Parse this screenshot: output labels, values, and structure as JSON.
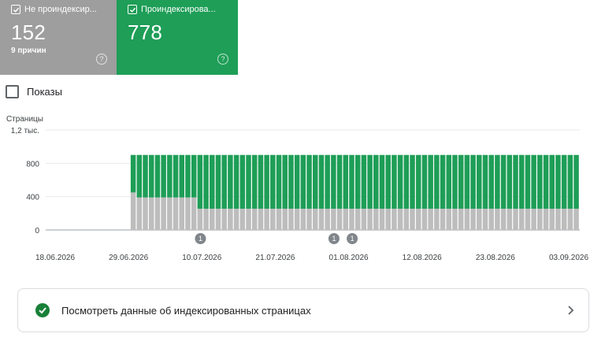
{
  "cards": {
    "not_indexed": {
      "label": "Не проиндексир...",
      "value": "152",
      "sub": "9 причин",
      "color": "#9e9e9e",
      "checked": true
    },
    "indexed": {
      "label": "Проиндексирова...",
      "value": "778",
      "color": "#1e9e57",
      "checked": true
    }
  },
  "impressions_toggle": {
    "label": "Показы",
    "checked": false
  },
  "chart_data": {
    "type": "bar",
    "stacked": true,
    "ylabel": "Страницы",
    "yticks": [
      "1,2 тыс.",
      "800",
      "400",
      "0"
    ],
    "ylim": [
      0,
      1200
    ],
    "grid": true,
    "xtick_labels": [
      "18.06.2026",
      "29.06.2026",
      "10.07.2026",
      "21.07.2026",
      "01.08.2026",
      "12.08.2026",
      "23.08.2026",
      "03.09.2026"
    ],
    "annotations": [
      {
        "category_index": 25,
        "label": "1"
      },
      {
        "category_index": 47,
        "label": "1"
      },
      {
        "category_index": 50,
        "label": "1"
      }
    ],
    "series": [
      {
        "color": "#bdbdbd",
        "values": [
          0,
          0,
          0,
          0,
          0,
          0,
          0,
          0,
          0,
          0,
          0,
          0,
          0,
          0,
          450,
          390,
          390,
          390,
          390,
          390,
          390,
          390,
          390,
          390,
          390,
          255,
          255,
          255,
          255,
          255,
          255,
          255,
          255,
          255,
          255,
          255,
          255,
          255,
          255,
          255,
          255,
          255,
          255,
          255,
          255,
          255,
          255,
          255,
          255,
          255,
          255,
          255,
          255,
          255,
          255,
          255,
          255,
          255,
          255,
          255,
          255,
          255,
          255,
          255,
          255,
          255,
          255,
          255,
          255,
          255,
          255,
          255,
          255,
          255,
          255,
          255,
          255,
          255,
          255,
          255,
          255,
          255,
          255,
          255,
          255,
          255,
          255,
          255
        ]
      },
      {
        "color": "#1e9e57",
        "values": [
          0,
          0,
          0,
          0,
          0,
          0,
          0,
          0,
          0,
          0,
          0,
          0,
          0,
          0,
          450,
          510,
          510,
          510,
          510,
          510,
          510,
          510,
          510,
          510,
          510,
          645,
          645,
          645,
          645,
          645,
          645,
          645,
          645,
          645,
          645,
          645,
          645,
          645,
          645,
          645,
          645,
          645,
          645,
          645,
          645,
          645,
          645,
          645,
          645,
          645,
          645,
          645,
          645,
          645,
          645,
          645,
          645,
          645,
          645,
          645,
          645,
          645,
          645,
          645,
          645,
          645,
          645,
          645,
          645,
          645,
          645,
          645,
          645,
          645,
          645,
          645,
          645,
          645,
          645,
          645,
          645,
          645,
          645,
          645,
          645,
          645,
          645,
          645
        ]
      }
    ]
  },
  "details_link": {
    "label": "Посмотреть данные об индексированных страницах"
  }
}
